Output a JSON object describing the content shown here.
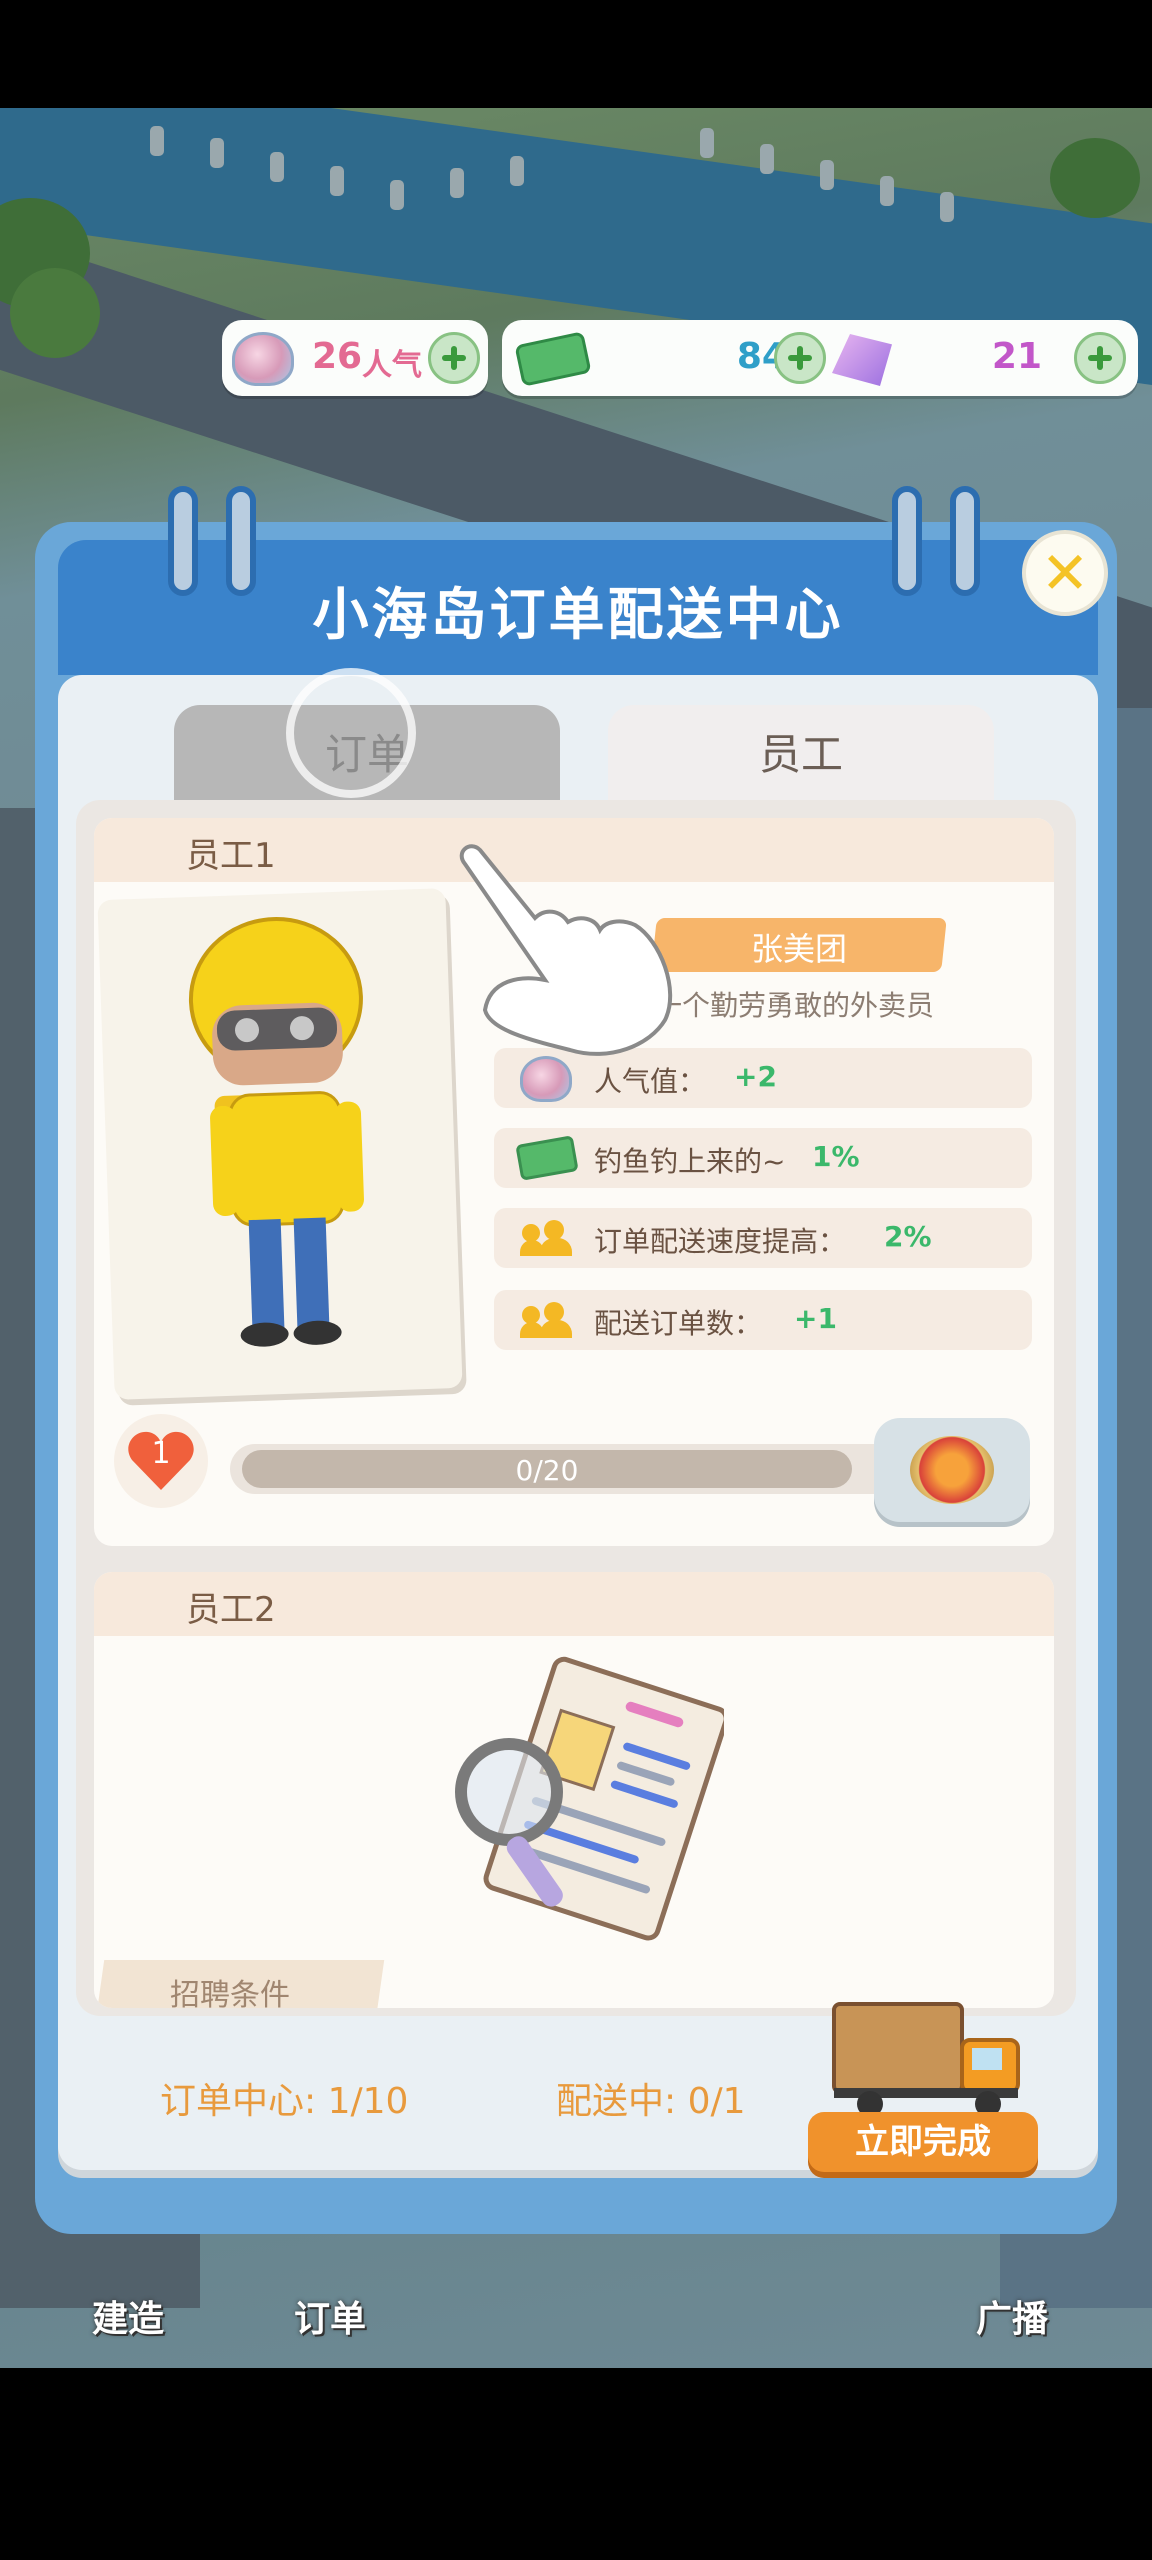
{
  "currency": {
    "popularity": {
      "value": "26",
      "unit": "人气",
      "icon": "shell-icon"
    },
    "cash": {
      "value": "844",
      "icon": "cash-icon"
    },
    "gems": {
      "value": "21",
      "icon": "gem-icon"
    }
  },
  "panel": {
    "title": "小海岛订单配送中心",
    "tabs": [
      {
        "label": "订单",
        "active": false
      },
      {
        "label": "员工",
        "active": true
      }
    ]
  },
  "staff": [
    {
      "header": "员工1",
      "name": "张美团",
      "description": "一个勤劳勇敢的外卖员",
      "stats": [
        {
          "icon": "shell-icon",
          "label": "人气值：",
          "value": "+2"
        },
        {
          "icon": "cash-icon",
          "label": "钓鱼钓上来的~",
          "value": "1%"
        },
        {
          "icon": "people-icon",
          "label": "订单配送速度提高：",
          "value": "2%"
        },
        {
          "icon": "people-icon",
          "label": "配送订单数：",
          "value": "+1"
        }
      ],
      "level": "1",
      "progress_text": "0/20",
      "progress_fraction": 0.0,
      "reward_icon": "hotpot-icon"
    },
    {
      "header": "员工2",
      "recruit_label": "招聘条件",
      "illustration": "resume-magnifier-icon"
    }
  ],
  "footer": {
    "order_center": "订单中心: 1/10",
    "delivering": "配送中: 0/1",
    "finish_button": "立即完成"
  },
  "bottom_nav": [
    {
      "label": "建造"
    },
    {
      "label": "订单"
    },
    {
      "label": "广播"
    }
  ],
  "colors": {
    "header_blue": "#3a83cb",
    "accent_orange": "#f0922c",
    "stat_green": "#3bb86b"
  }
}
